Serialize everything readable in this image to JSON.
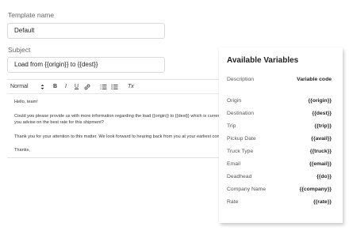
{
  "form": {
    "template_name_label": "Template name",
    "template_name_value": "Default",
    "subject_label": "Subject",
    "subject_value": "Load from {{origin}} to {{dest}}"
  },
  "toolbar": {
    "format_select": "Normal",
    "bold": "B",
    "italic": "I",
    "underline": "U",
    "clear_format": "Tx"
  },
  "editor": {
    "lines": [
      "Hello, team!",
      "Could you please provide us with more information regarding the load {{origin}} to {{dest}} which is currently available on the load board? Could",
      "you advise on the best rate for this shipment?",
      "Thank you for your attention to this matter. We look forward to hearing back from you at your earliest convenience.",
      "Thanks,"
    ]
  },
  "variables_panel": {
    "title": "Available Variables",
    "col_description": "Description",
    "col_code": "Variable code",
    "rows": [
      {
        "description": "Origin",
        "code": "{{origin}}"
      },
      {
        "description": "Destination",
        "code": "{{dest}}"
      },
      {
        "description": "Trip",
        "code": "{{trip}}"
      },
      {
        "description": "Pickup Date",
        "code": "{{avail}}"
      },
      {
        "description": "Truck Type",
        "code": "{{truck}}"
      },
      {
        "description": "Email",
        "code": "{{email}}"
      },
      {
        "description": "Deadhead",
        "code": "{{do}}"
      },
      {
        "description": "Company Name",
        "code": "{{company}}"
      },
      {
        "description": "Rate",
        "code": "{{rate}}"
      }
    ]
  }
}
